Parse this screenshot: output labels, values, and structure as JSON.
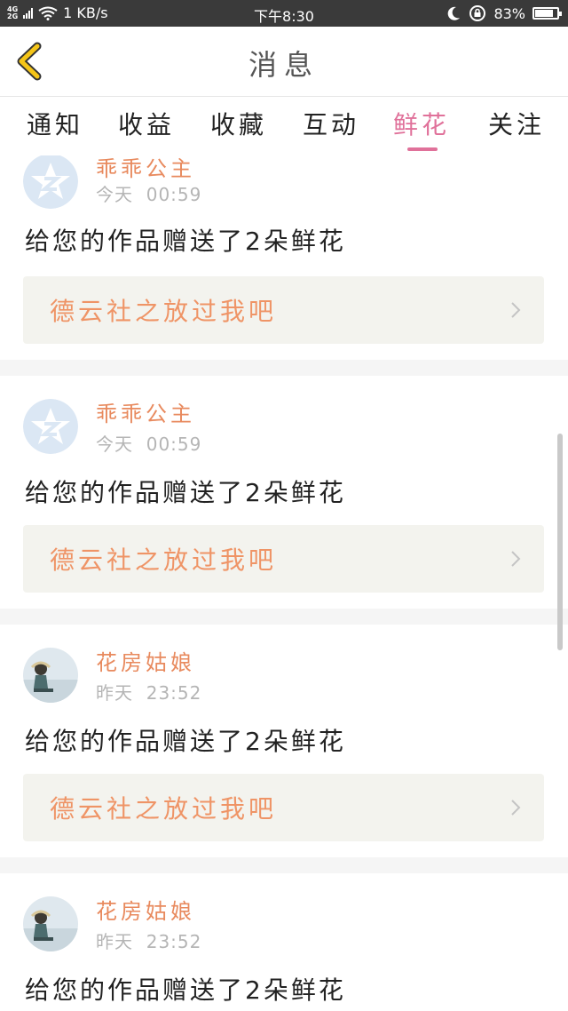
{
  "status_bar": {
    "network_top": "4G",
    "network_bottom": "2G",
    "speed": "1 KB/s",
    "time": "下午8:30",
    "battery": "83%",
    "battery_level": 0.83,
    "icons": [
      "signal-icon",
      "wifi-icon",
      "moon-icon",
      "rotation-lock-icon",
      "battery-icon"
    ]
  },
  "header": {
    "title": "消息",
    "back_icon": "chevron-left-icon",
    "accent_color": "#f5c518"
  },
  "tabs": [
    {
      "label": "通知",
      "active": false
    },
    {
      "label": "收益",
      "active": false
    },
    {
      "label": "收藏",
      "active": false
    },
    {
      "label": "互动",
      "active": false
    },
    {
      "label": "鲜花",
      "active": true
    },
    {
      "label": "关注",
      "active": false
    }
  ],
  "colors": {
    "active_tab": "#e0719a",
    "username": "#e88a5e",
    "work_title": "#ef9466"
  },
  "messages": [
    {
      "user": "乖乖公主",
      "day": "今天",
      "time": "00:59",
      "text": "给您的作品赠送了2朵鲜花",
      "work": "德云社之放过我吧",
      "avatar": "default-avatar-icon"
    },
    {
      "user": "乖乖公主",
      "day": "今天",
      "time": "00:59",
      "text": "给您的作品赠送了2朵鲜花",
      "work": "德云社之放过我吧",
      "avatar": "default-avatar-icon"
    },
    {
      "user": "花房姑娘",
      "day": "昨天",
      "time": "23:52",
      "text": "给您的作品赠送了2朵鲜花",
      "work": "德云社之放过我吧",
      "avatar": "photo-avatar"
    },
    {
      "user": "花房姑娘",
      "day": "昨天",
      "time": "23:52",
      "text": "给您的作品赠送了2朵鲜花",
      "work": "德云社之放过我吧",
      "avatar": "photo-avatar"
    }
  ]
}
